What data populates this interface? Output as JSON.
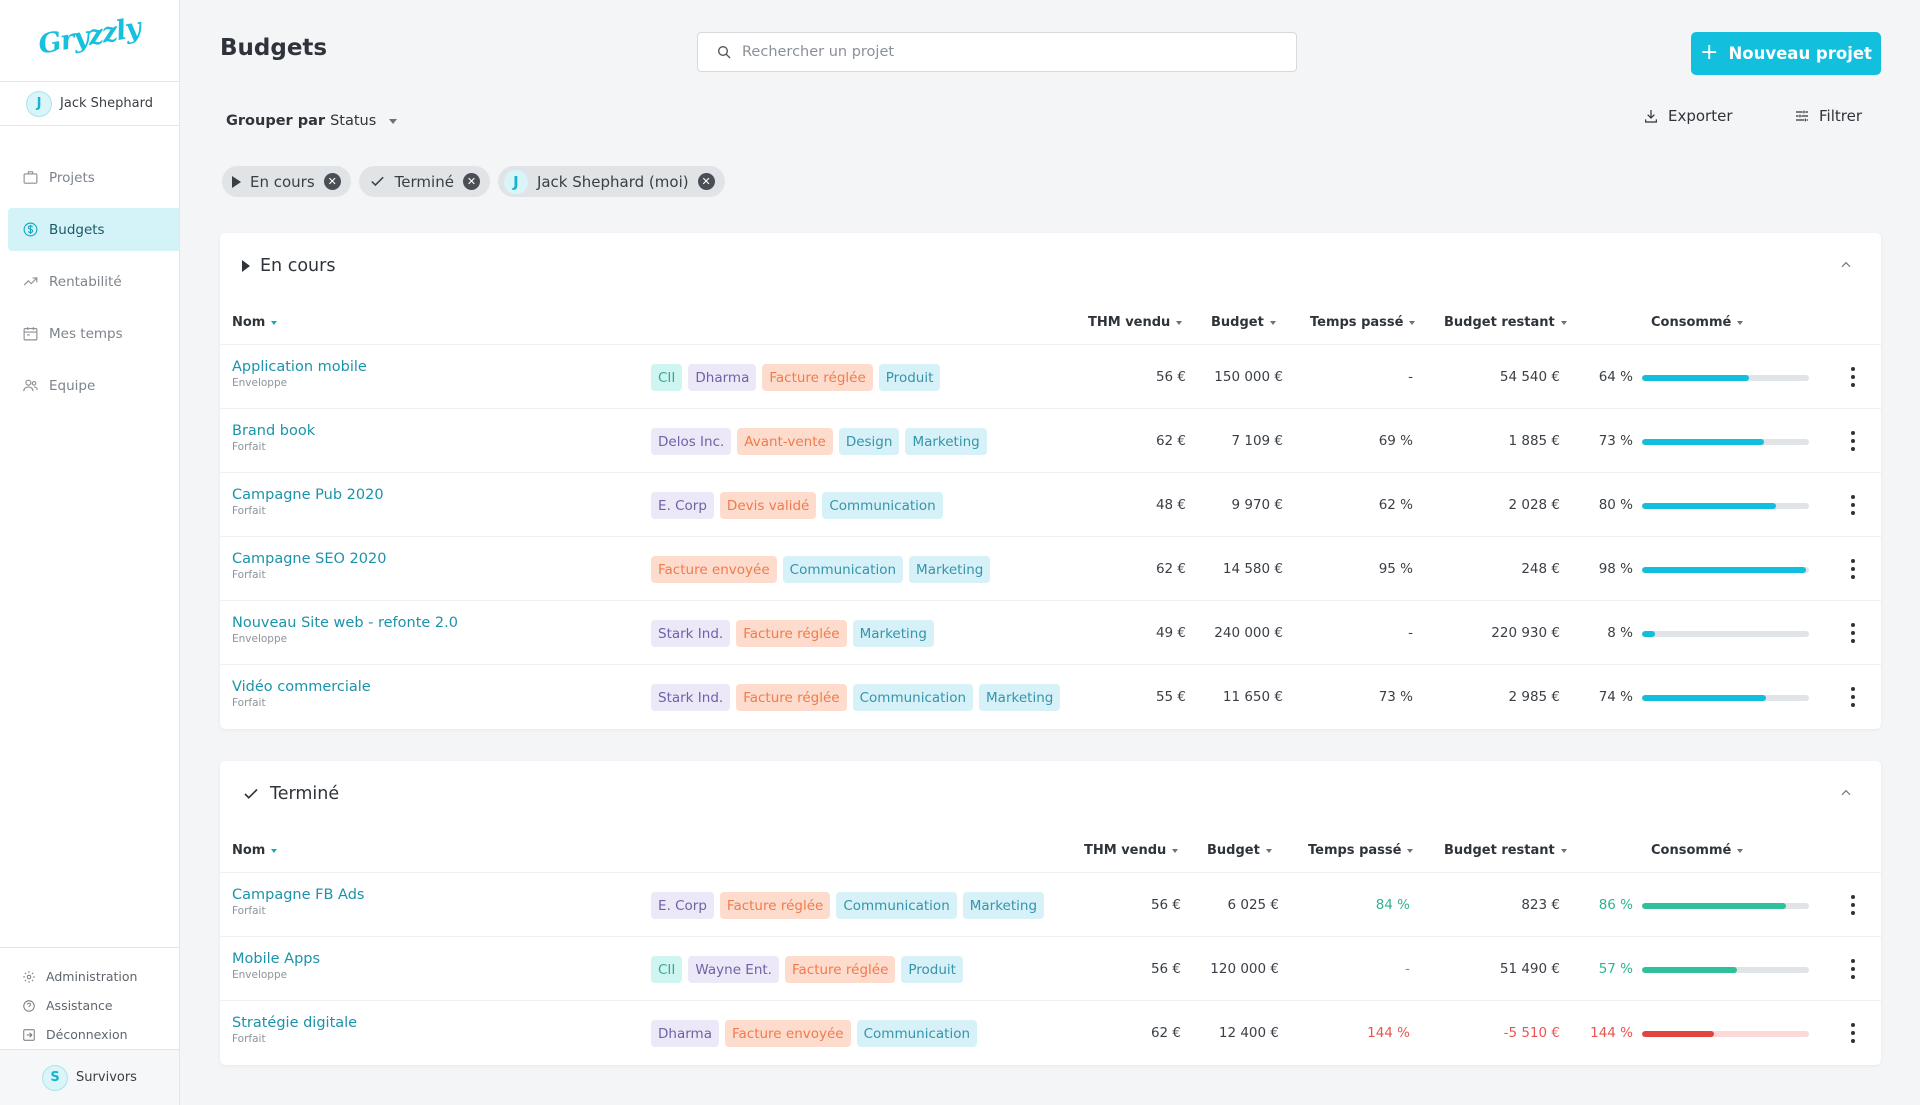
{
  "sidebar": {
    "logo": "Gryzzly",
    "user": {
      "initial": "J",
      "name": "Jack Shephard"
    },
    "nav": [
      {
        "label": "Projets",
        "icon": "briefcase-icon",
        "active": false
      },
      {
        "label": "Budgets",
        "icon": "dollar-icon",
        "active": true
      },
      {
        "label": "Rentabilité",
        "icon": "trend-icon",
        "active": false
      },
      {
        "label": "Mes temps",
        "icon": "calendar-icon",
        "active": false
      },
      {
        "label": "Equipe",
        "icon": "team-icon",
        "active": false
      }
    ],
    "bottom_links": [
      {
        "label": "Administration",
        "icon": "gear-icon"
      },
      {
        "label": "Assistance",
        "icon": "help-icon"
      },
      {
        "label": "Déconnexion",
        "icon": "logout-icon"
      }
    ],
    "org": {
      "initial": "S",
      "name": "Survivors"
    }
  },
  "header": {
    "title": "Budgets",
    "search_placeholder": "Rechercher un projet",
    "new_button": "Nouveau projet",
    "group_by_prefix": "Grouper par",
    "group_by_value": "Status",
    "export_label": "Exporter",
    "filter_label": "Filtrer"
  },
  "filters": {
    "chips": [
      {
        "label": "En cours",
        "icon": "play-icon"
      },
      {
        "label": "Terminé",
        "icon": "check-icon"
      },
      {
        "label": "Jack Shephard (moi)",
        "initial": "J"
      }
    ]
  },
  "columns": {
    "name": "Nom",
    "thm": "THM vendu",
    "budget": "Budget",
    "time": "Temps passé",
    "remaining": "Budget restant",
    "consumed": "Consommé"
  },
  "colors": {
    "accent": "#12c0dd",
    "link": "#1b93ac",
    "progress_blue": "#12bedd",
    "progress_green": "#2dc09b",
    "progress_red": "#e2443f"
  },
  "sections": [
    {
      "title": "En cours",
      "icon": "play-icon",
      "rows": [
        {
          "name": "Application mobile",
          "type": "Enveloppe",
          "tags": [
            [
              "CII",
              "teal"
            ],
            [
              "Dharma",
              "purple"
            ],
            [
              "Facture réglée",
              "orange"
            ],
            [
              "Produit",
              "blue"
            ]
          ],
          "thm": "56 €",
          "budget": "150 000 €",
          "time": "-",
          "remaining": "54 540 €",
          "consumed": "64 %",
          "progress": 0.64,
          "status": "normal"
        },
        {
          "name": "Brand book",
          "type": "Forfait",
          "tags": [
            [
              "Delos Inc.",
              "purple"
            ],
            [
              "Avant-vente",
              "orange"
            ],
            [
              "Design",
              "blue"
            ],
            [
              "Marketing",
              "blue"
            ]
          ],
          "thm": "62 €",
          "budget": "7 109 €",
          "time": "69 %",
          "remaining": "1 885 €",
          "consumed": "73 %",
          "progress": 0.73,
          "status": "normal"
        },
        {
          "name": "Campagne Pub 2020",
          "type": "Forfait",
          "tags": [
            [
              "E. Corp",
              "purple"
            ],
            [
              "Devis validé",
              "orange"
            ],
            [
              "Communication",
              "blue"
            ]
          ],
          "thm": "48 €",
          "budget": "9 970 €",
          "time": "62 %",
          "remaining": "2 028 €",
          "consumed": "80 %",
          "progress": 0.8,
          "status": "normal"
        },
        {
          "name": "Campagne SEO 2020",
          "type": "Forfait",
          "tags": [
            [
              "Facture envoyée",
              "orange"
            ],
            [
              "Communication",
              "blue"
            ],
            [
              "Marketing",
              "blue"
            ]
          ],
          "thm": "62 €",
          "budget": "14 580 €",
          "time": "95 %",
          "remaining": "248 €",
          "consumed": "98 %",
          "progress": 0.98,
          "status": "normal"
        },
        {
          "name": "Nouveau Site web - refonte 2.0",
          "type": "Enveloppe",
          "tags": [
            [
              "Stark Ind.",
              "purple"
            ],
            [
              "Facture réglée",
              "orange"
            ],
            [
              "Marketing",
              "blue"
            ]
          ],
          "thm": "49 €",
          "budget": "240 000 €",
          "time": "-",
          "remaining": "220 930 €",
          "consumed": "8 %",
          "progress": 0.08,
          "status": "normal"
        },
        {
          "name": "Vidéo commerciale",
          "type": "Forfait",
          "tags": [
            [
              "Stark Ind.",
              "purple"
            ],
            [
              "Facture réglée",
              "orange"
            ],
            [
              "Communication",
              "blue"
            ],
            [
              "Marketing",
              "blue"
            ]
          ],
          "thm": "55 €",
          "budget": "11 650 €",
          "time": "73 %",
          "remaining": "2 985 €",
          "consumed": "74 %",
          "progress": 0.74,
          "status": "normal"
        }
      ]
    },
    {
      "title": "Terminé",
      "icon": "check-icon",
      "rows": [
        {
          "name": "Campagne FB Ads",
          "type": "Forfait",
          "tags": [
            [
              "E. Corp",
              "purple"
            ],
            [
              "Facture réglée",
              "orange"
            ],
            [
              "Communication",
              "blue"
            ],
            [
              "Marketing",
              "blue"
            ]
          ],
          "thm": "56 €",
          "budget": "6 025 €",
          "time": "84 %",
          "remaining": "823 €",
          "consumed": "86 %",
          "progress": 0.86,
          "status": "good"
        },
        {
          "name": "Mobile Apps",
          "type": "Enveloppe",
          "tags": [
            [
              "CII",
              "teal"
            ],
            [
              "Wayne Ent.",
              "purple"
            ],
            [
              "Facture réglée",
              "orange"
            ],
            [
              "Produit",
              "blue"
            ]
          ],
          "thm": "56 €",
          "budget": "120 000 €",
          "time": "-",
          "remaining": "51 490 €",
          "consumed": "57 %",
          "progress": 0.57,
          "status": "good"
        },
        {
          "name": "Stratégie digitale",
          "type": "Forfait",
          "tags": [
            [
              "Dharma",
              "purple"
            ],
            [
              "Facture envoyée",
              "orange"
            ],
            [
              "Communication",
              "blue"
            ]
          ],
          "thm": "62 €",
          "budget": "12 400 €",
          "time": "144 %",
          "remaining": "-5 510 €",
          "consumed": "144 %",
          "progress": 1.44,
          "status": "over"
        }
      ]
    }
  ]
}
